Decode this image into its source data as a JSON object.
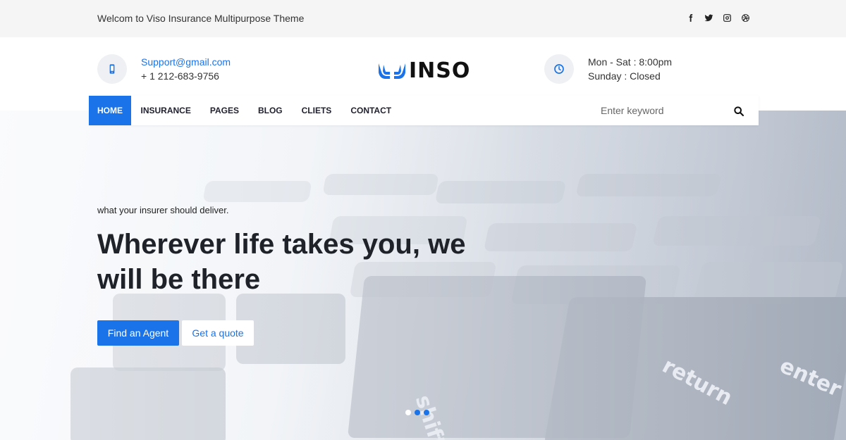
{
  "topbar": {
    "welcome": "Welcom to Viso Insurance Multipurpose Theme",
    "socials": [
      "facebook-icon",
      "twitter-icon",
      "instagram-icon",
      "dribbble-icon"
    ]
  },
  "header": {
    "email": "Support@gmail.com",
    "phone": "+ 1 212-683-9756",
    "logo_text": "INSO",
    "hours_line1": "Mon - Sat : 8:00pm",
    "hours_line2": "Sunday : Closed"
  },
  "nav": {
    "items": [
      "HOME",
      "INSURANCE",
      "PAGES",
      "BLOG",
      "CLIETS",
      "CONTACT"
    ],
    "active": "HOME",
    "search_placeholder": "Enter keyword"
  },
  "hero": {
    "tagline": "what your insurer should deliver.",
    "headline_line1": "Wherever life takes you, we",
    "headline_line2": "will be there",
    "primary_button": "Find an Agent",
    "secondary_button": "Get a quote",
    "key_labels": [
      "shift",
      "return",
      "enter"
    ],
    "slide_count": 3,
    "active_slide": 1
  },
  "colors": {
    "accent": "#1a73e8",
    "topbar_bg": "#f5f5f5",
    "text_dark": "#1f2229"
  }
}
